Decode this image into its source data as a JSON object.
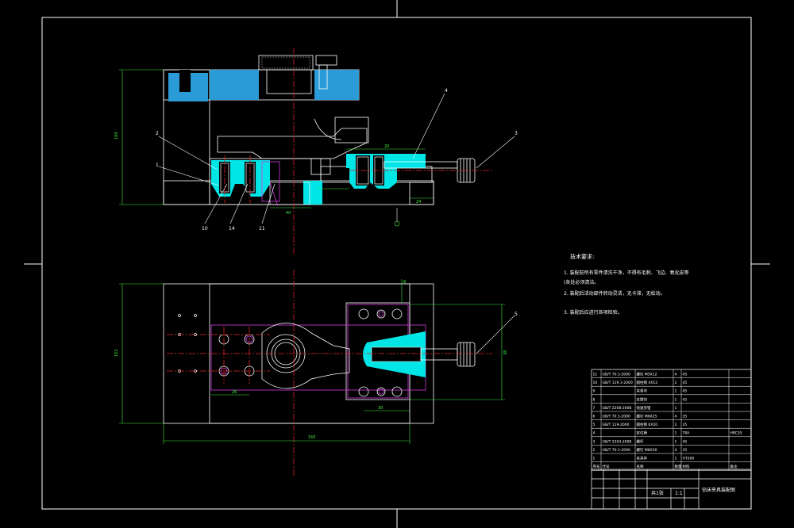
{
  "colors": {
    "background": "#000000",
    "outline": "#ffffff",
    "section_fill": "#2a9bd6",
    "cyan_fill": "#00e5e5",
    "dimension": "#39e639",
    "centerline": "#e02424",
    "construction": "#d23be0"
  },
  "tech_notes": {
    "title": "技术要求:",
    "lines": [
      "1. 装配前所有零件清洗干净，不得有毛刺、飞边、氧化皮等",
      "   (各处必须清洁。",
      "2. 装配后活动部件转动灵活，无卡滞，无松动。",
      "3. 装配后应进行各项检验。"
    ]
  },
  "dimensions": {
    "front_height": "100",
    "plan_height": "152",
    "plan_width": "165",
    "plan_right": "38",
    "dim_20": "20",
    "dim_26": "26",
    "dim_40": "40",
    "dim_30": "30",
    "dim_24": "24",
    "dim_8": "8"
  },
  "balloons": {
    "b1": "1",
    "b2": "2",
    "b3": "3",
    "b4": "4",
    "b5": "5",
    "b10": "10",
    "b11": "11",
    "b14": "14"
  },
  "bom": {
    "rows": [
      {
        "no": "11",
        "code": "GB/T 70.1-2000",
        "name": "螺钉 M5X12",
        "qty": "4",
        "material": "45",
        "note": ""
      },
      {
        "no": "10",
        "code": "GB/T 119.1-2000",
        "name": "圆柱销 4X12",
        "qty": "2",
        "material": "45",
        "note": ""
      },
      {
        "no": "9",
        "code": "",
        "name": "夹紧块",
        "qty": "1",
        "material": "45",
        "note": ""
      },
      {
        "no": "8",
        "code": "",
        "name": "支撑块",
        "qty": "1",
        "material": "45",
        "note": ""
      },
      {
        "no": "7",
        "code": "GB/T 2208-2008",
        "name": "快速夹钳",
        "qty": "1",
        "material": "",
        "note": ""
      },
      {
        "no": "6",
        "code": "GB/T 70.1-2000",
        "name": "螺钉 M6X25",
        "qty": "4",
        "material": "35",
        "note": ""
      },
      {
        "no": "5",
        "code": "GB/T 119-2000",
        "name": "圆柱销 6X20",
        "qty": "2",
        "material": "35",
        "note": ""
      },
      {
        "no": "4",
        "code": "",
        "name": "定位销",
        "qty": "1",
        "material": "T8A",
        "note": "HRC55"
      },
      {
        "no": "3",
        "code": "GB/T 2204-2008",
        "name": "螺杆",
        "qty": "1",
        "material": "45",
        "note": ""
      },
      {
        "no": "2",
        "code": "GB/T 70.1-2000",
        "name": "螺钉 M8X30",
        "qty": "4",
        "material": "35",
        "note": ""
      },
      {
        "no": "1",
        "code": "",
        "name": "夹具体",
        "qty": "1",
        "material": "HT200",
        "note": ""
      }
    ],
    "header": {
      "no": "序号",
      "code": "代号",
      "name": "名称",
      "qty": "数量",
      "material": "材料",
      "note": "备注"
    }
  },
  "title_block": {
    "drawing_name": "钻床夹具装配图",
    "scale": "1:1",
    "sheet": "共1张"
  }
}
